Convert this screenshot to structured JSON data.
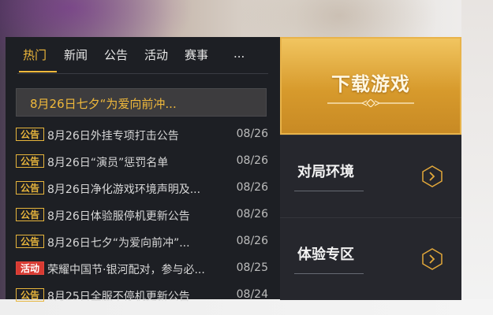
{
  "tabs": [
    {
      "label": "热门",
      "active": true
    },
    {
      "label": "新闻",
      "active": false
    },
    {
      "label": "公告",
      "active": false
    },
    {
      "label": "活动",
      "active": false
    },
    {
      "label": "赛事",
      "active": false
    },
    {
      "label": "...",
      "active": false
    }
  ],
  "featured": {
    "title": "8月26日七夕“为爱向前冲..."
  },
  "news": [
    {
      "badge": "公告",
      "title": "8月26日外挂专项打击公告",
      "date": "08/26",
      "badge_type": "notice"
    },
    {
      "badge": "公告",
      "title": "8月26日“演员”惩罚名单",
      "date": "08/26",
      "badge_type": "notice"
    },
    {
      "badge": "公告",
      "title": "8月26日净化游戏环境声明及...",
      "date": "08/26",
      "badge_type": "notice"
    },
    {
      "badge": "公告",
      "title": "8月26日体验服停机更新公告",
      "date": "08/26",
      "badge_type": "notice"
    },
    {
      "badge": "公告",
      "title": "8月26日七夕“为爱向前冲”...",
      "date": "08/26",
      "badge_type": "notice"
    },
    {
      "badge": "活动",
      "title": "荣耀中国节·银河配对，参与必...",
      "date": "08/25",
      "badge_type": "event"
    },
    {
      "badge": "公告",
      "title": "8月25日全服不停机更新公告",
      "date": "08/24",
      "badge_type": "notice"
    }
  ],
  "side": {
    "download_label": "下载游戏",
    "entries": [
      {
        "label": "对局环境"
      },
      {
        "label": "体验专区"
      }
    ]
  },
  "colors": {
    "accent": "#f0b93b",
    "panel": "#1d1f24",
    "event_red": "#d83a32"
  }
}
